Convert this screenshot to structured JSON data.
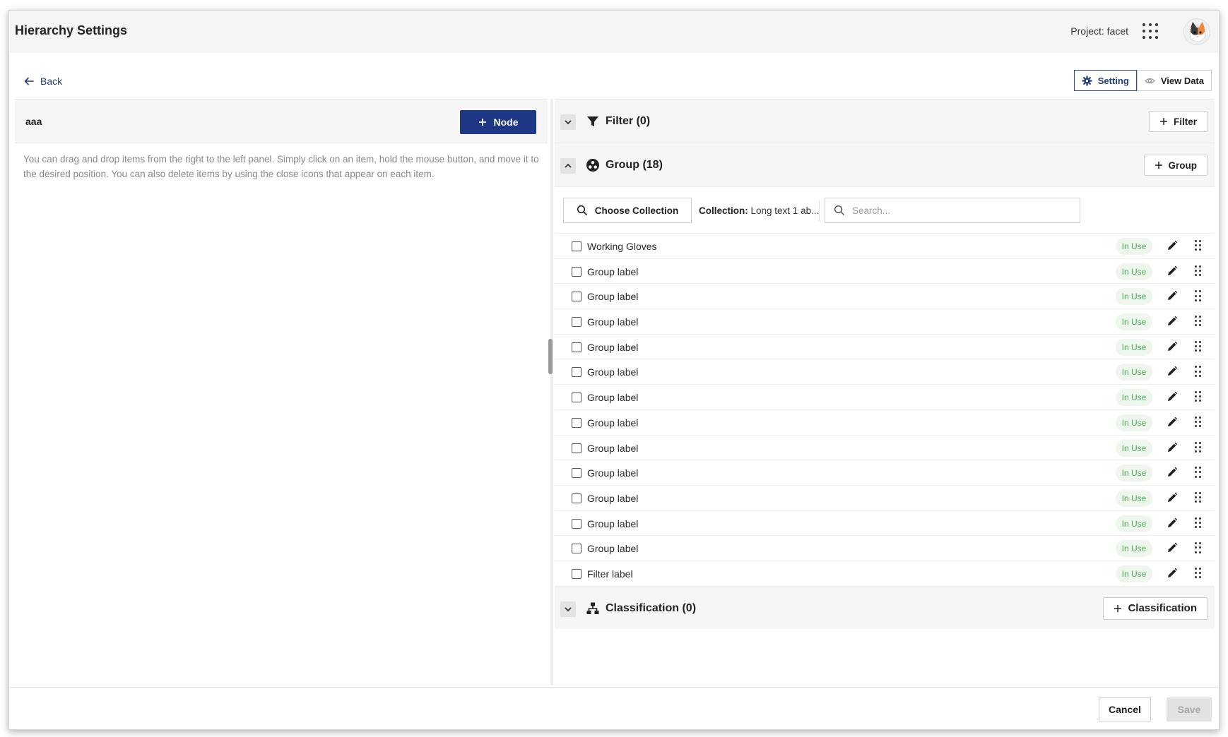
{
  "header": {
    "title": "Hierarchy Settings",
    "project": "Project: facet"
  },
  "toolbar": {
    "back_label": "Back",
    "setting_label": "Setting",
    "view_data_label": "View Data"
  },
  "left": {
    "title": "aaa",
    "node_button": "Node",
    "help_text": "You can drag and drop items from the right to the left panel. Simply click on an item, hold the mouse button, and move it to the desired position. You can also delete items by using the close icons that appear on each item."
  },
  "filter": {
    "title": "Filter (0)",
    "button": "Filter"
  },
  "group": {
    "title": "Group (18)",
    "button": "Group",
    "choose_collection": "Choose Collection",
    "collection_key": "Collection:",
    "collection_value": "Long text 1 ab...",
    "search_placeholder": "Search...",
    "status_label": "In Use",
    "items": [
      {
        "label": "Working Gloves"
      },
      {
        "label": "Group label"
      },
      {
        "label": "Group label"
      },
      {
        "label": "Group label"
      },
      {
        "label": "Group label"
      },
      {
        "label": "Group label"
      },
      {
        "label": "Group label"
      },
      {
        "label": "Group label"
      },
      {
        "label": "Group label"
      },
      {
        "label": "Group label"
      },
      {
        "label": "Group label"
      },
      {
        "label": "Group label"
      },
      {
        "label": "Group label"
      },
      {
        "label": "Filter label"
      }
    ]
  },
  "classification": {
    "title": "Classification (0)",
    "button": "Classification"
  },
  "footer": {
    "cancel": "Cancel",
    "save": "Save"
  },
  "colors": {
    "primary": "#1f3885",
    "status_green": "#4caf50",
    "status_bg": "#eef6ee"
  }
}
